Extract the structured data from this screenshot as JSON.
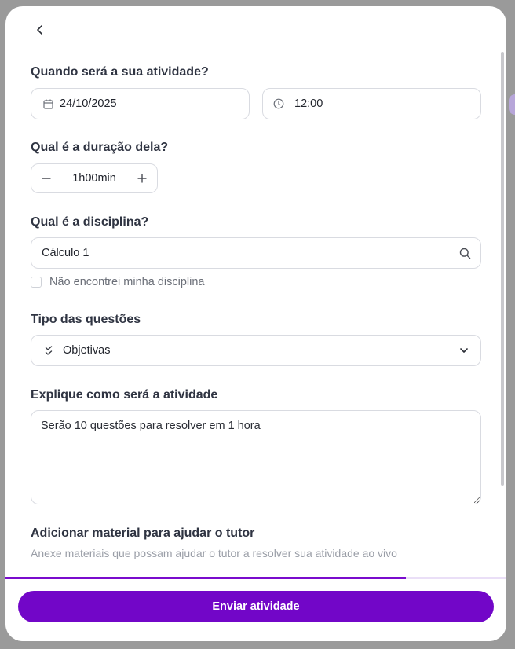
{
  "form": {
    "when": {
      "title": "Quando será a sua atividade?",
      "date": "24/10/2025",
      "time": "12:00"
    },
    "duration": {
      "title": "Qual é a duração dela?",
      "value": "1h00min"
    },
    "subject": {
      "title": "Qual é a disciplina?",
      "value": "Cálculo 1",
      "not_found_label": "Não encontrei minha disciplina"
    },
    "question_type": {
      "title": "Tipo das questões",
      "value": "Objetivas"
    },
    "explain": {
      "title": "Explique como será a atividade",
      "value": "Serão 10 questões para resolver em 1 hora"
    },
    "material": {
      "title": "Adicionar material para ajudar o tutor",
      "subtitle": "Anexe materiais que possam ajudar o tutor a resolver sua atividade ao vivo"
    }
  },
  "progress": {
    "fraction": 0.8
  },
  "footer": {
    "submit_label": "Enviar atividade"
  },
  "colors": {
    "accent": "#7206c8",
    "progress_track": "#eadff7"
  },
  "icons": {
    "back": "chevron-left-icon",
    "date": "calendar-icon",
    "time": "clock-icon",
    "minus": "minus-icon",
    "plus": "plus-icon",
    "search": "search-icon",
    "type": "double-check-icon",
    "dropdown": "chevron-down-icon"
  }
}
